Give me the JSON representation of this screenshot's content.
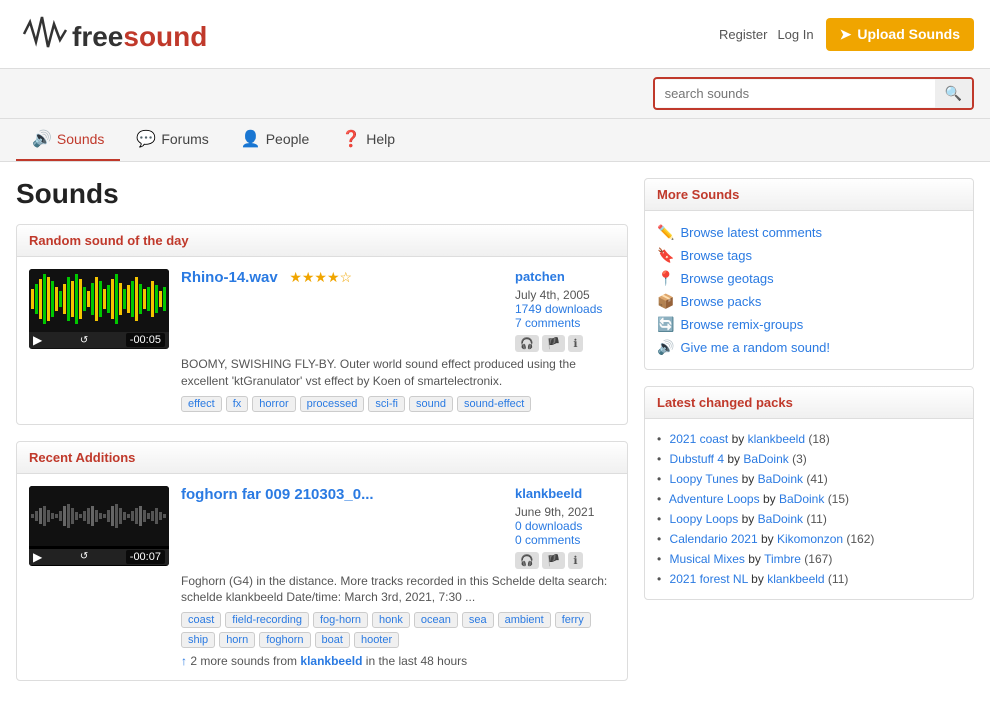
{
  "site": {
    "name": "freesound",
    "logo_text": "freesound"
  },
  "header": {
    "register_label": "Register",
    "login_label": "Log In",
    "upload_label": "Upload Sounds",
    "search_placeholder": "search sounds"
  },
  "nav": {
    "items": [
      {
        "id": "sounds",
        "label": "Sounds",
        "icon": "🔊",
        "active": true
      },
      {
        "id": "forums",
        "label": "Forums",
        "icon": "💬",
        "active": false
      },
      {
        "id": "people",
        "label": "People",
        "icon": "👤",
        "active": false
      },
      {
        "id": "help",
        "label": "Help",
        "icon": "❓",
        "active": false
      }
    ]
  },
  "page": {
    "title": "Sounds"
  },
  "random_sound": {
    "panel_title": "Random sound of the day",
    "sound_title": "Rhino-14.wav",
    "sound_url": "#",
    "duration": "-00:05",
    "stars": "★★★★☆",
    "description": "BOOMY, SWISHING FLY-BY. Outer world sound effect produced using the excellent 'ktGranulator' vst effect by Koen of smartelectronix.",
    "username": "patchen",
    "date": "July 4th, 2005",
    "downloads": "1749 downloads",
    "comments": "7 comments",
    "tags": [
      "effect",
      "fx",
      "horror",
      "processed",
      "sci-fi",
      "sound",
      "sound-effect"
    ]
  },
  "recent_additions": {
    "panel_title": "Recent Additions",
    "sound_title": "foghorn far 009 210303_0...",
    "sound_url": "#",
    "duration": "-00:07",
    "stars": "",
    "description": "Foghorn (G4) in the distance. More tracks recorded in this Schelde delta search: schelde klankbeeld Date/time: March 3rd, 2021, 7:30 ...",
    "username": "klankbeeld",
    "date": "June 9th, 2021",
    "downloads": "0 downloads",
    "comments": "0 comments",
    "tags": [
      "coast",
      "field-recording",
      "fog-horn",
      "honk",
      "ocean",
      "sea",
      "ambient",
      "ferry",
      "ship",
      "horn",
      "foghorn",
      "boat",
      "hooter"
    ],
    "more_note": "2 more sounds from",
    "more_user": "klankbeeld",
    "more_text": "in the last 48 hours"
  },
  "more_sounds": {
    "panel_title": "More Sounds",
    "links": [
      {
        "id": "latest-comments",
        "label": "Browse latest comments",
        "icon": "✏️"
      },
      {
        "id": "browse-tags",
        "label": "Browse tags",
        "icon": "🔖"
      },
      {
        "id": "browse-geotags",
        "label": "Browse geotags",
        "icon": "📍"
      },
      {
        "id": "browse-packs",
        "label": "Browse packs",
        "icon": "📦"
      },
      {
        "id": "browse-remix-groups",
        "label": "Browse remix-groups",
        "icon": "🔄"
      },
      {
        "id": "random-sound",
        "label": "Give me a random sound!",
        "icon": "🔊"
      }
    ]
  },
  "latest_changed_packs": {
    "panel_title": "Latest changed packs",
    "packs": [
      {
        "name": "2021 coast",
        "by": "by",
        "user": "klankbeeld",
        "count": "(18)"
      },
      {
        "name": "Dubstuff 4",
        "by": "by",
        "user": "BaDoink",
        "count": "(3)"
      },
      {
        "name": "Loopy Tunes",
        "by": "by",
        "user": "BaDoink",
        "count": "(41)"
      },
      {
        "name": "Adventure Loops",
        "by": "by",
        "user": "BaDoink",
        "count": "(15)"
      },
      {
        "name": "Loopy Loops",
        "by": "by",
        "user": "BaDoink",
        "count": "(11)"
      },
      {
        "name": "Calendario 2021",
        "by": "by",
        "user": "Kikomonzon",
        "count": "(162)"
      },
      {
        "name": "Musical Mixes",
        "by": "by",
        "user": "Timbre",
        "count": "(167)"
      },
      {
        "name": "2021 forest NL",
        "by": "by",
        "user": "klankbeeld",
        "count": "(11)"
      }
    ]
  }
}
